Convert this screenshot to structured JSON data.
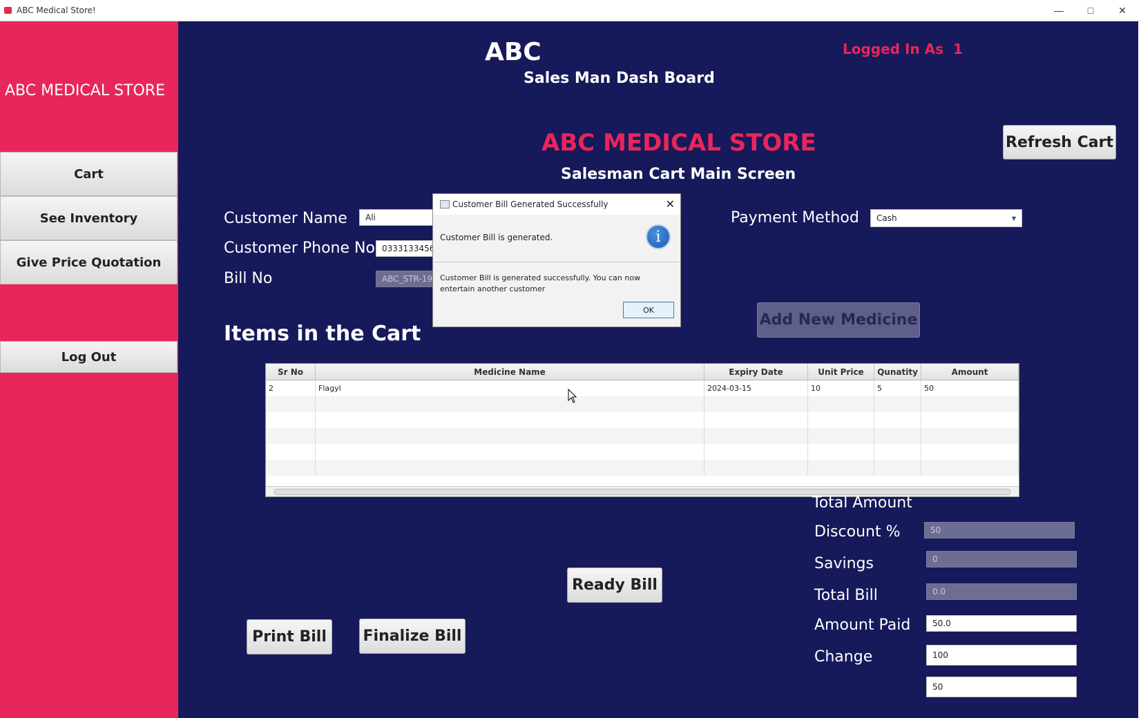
{
  "window": {
    "title": "ABC Medical Store!"
  },
  "sidebar": {
    "brand": "ABC MEDICAL STORE",
    "items": [
      {
        "label": "Cart"
      },
      {
        "label": "See Inventory"
      },
      {
        "label": "Give Price Quotation"
      },
      {
        "label": "Log Out"
      }
    ]
  },
  "header": {
    "title": "ABC",
    "subtitle": "Sales Man Dash Board",
    "logged_in_label": "Logged In As",
    "logged_in_value": "1"
  },
  "main": {
    "store_title": "ABC MEDICAL STORE",
    "screen_title": "Salesman Cart Main Screen",
    "refresh_button": "Refresh Cart",
    "add_medicine_button": "Add New Medicine",
    "customer_name_label": "Customer Name",
    "customer_name_value": "Ali",
    "customer_phone_label": "Customer Phone No",
    "customer_phone_value": "0333133456",
    "bill_no_label": "Bill No",
    "bill_no_value": "ABC_STR-196",
    "payment_label": "Payment Method",
    "payment_value": "Cash",
    "cart_heading": "Items in the Cart",
    "ready_bill_button": "Ready Bill",
    "print_bill_button": "Print Bill",
    "finalize_bill_button": "Finalize Bill"
  },
  "table": {
    "headers": [
      "Sr No",
      "Medicine Name",
      "Expiry Date",
      "Unit Price",
      "Qunatity",
      "Amount"
    ],
    "rows": [
      [
        "2",
        "Flagyl",
        "2024-03-15",
        "10",
        "5",
        "50"
      ]
    ]
  },
  "totals": {
    "total_amount_label": "Total Amount",
    "total_amount_value": "50",
    "discount_label": "Discount %",
    "discount_value": "0",
    "savings_label": "Savings",
    "savings_value": "0.0",
    "total_bill_label": "Total Bill",
    "total_bill_value": "50.0",
    "amount_paid_label": "Amount Paid",
    "amount_paid_value": "100",
    "change_label": "Change",
    "change_value": "50"
  },
  "dialog": {
    "title": "Customer Bill Generated Successfully",
    "header_text": "Customer Bill is generated.",
    "info_glyph": "i",
    "body_text": "Customer Bill is generated successfully. You can now entertain another customer",
    "ok_label": "OK"
  },
  "colors": {
    "sidebar": "#e8265b",
    "main_bg": "#16195a",
    "accent_text": "#e8265b"
  }
}
